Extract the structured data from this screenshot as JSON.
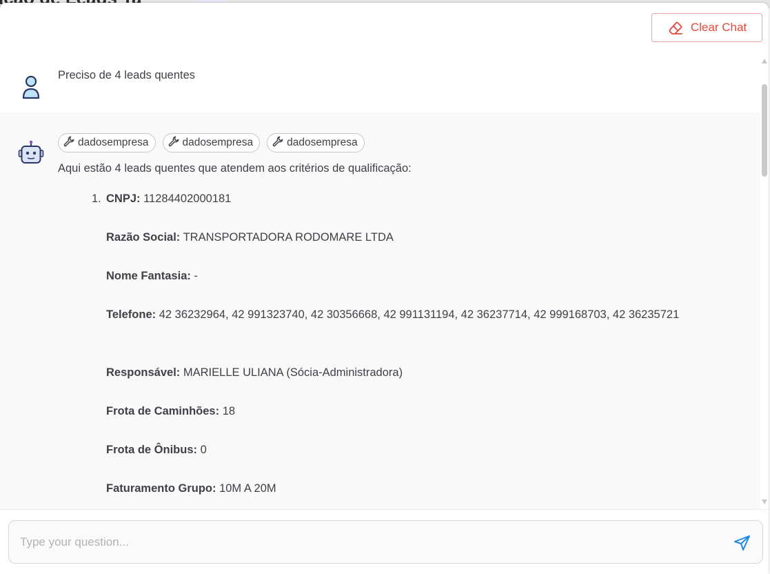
{
  "background": {
    "title_fragment": "icao de Leads   Ta"
  },
  "header": {
    "clear_label": "Clear Chat",
    "clear_icon": "eraser-icon"
  },
  "messages": {
    "user": {
      "avatar_icon": "user-icon",
      "text": "Preciso de 4 leads quentes"
    },
    "assistant": {
      "avatar_icon": "robot-icon",
      "tool_calls": [
        "dadosempresa",
        "dadosempresa",
        "dadosempresa"
      ],
      "intro": "Aqui estão 4 leads quentes que atendem aos critérios de qualificação:",
      "lead": {
        "number": "1.",
        "cnpj_label": "CNPJ:",
        "cnpj_value": " 11284402000181",
        "razao_label": "Razão Social:",
        "razao_value": " TRANSPORTADORA RODOMARE LTDA",
        "fantasia_label": "Nome Fantasia:",
        "fantasia_value": " -",
        "telefone_label": "Telefone:",
        "telefone_value": " 42 36232964, 42 991323740, 42 30356668, 42 991131194, 42 36237714, 42 999168703, 42 36235721",
        "responsavel_label": "Responsável:",
        "responsavel_value": " MARIELLE ULIANA (Sócia-Administradora)",
        "caminhoes_label": "Frota de Caminhões:",
        "caminhoes_value": " 18",
        "onibus_label": "Frota de Ônibus:",
        "onibus_value": " 0",
        "faturamento_label": "Faturamento Grupo:",
        "faturamento_value": " 10M A 20M"
      }
    }
  },
  "input": {
    "placeholder": "Type your question...",
    "value": "",
    "send_icon": "send-icon"
  },
  "colors": {
    "accent_red": "#e5483a",
    "send_blue": "#1e88e5",
    "bot_background": "#f9f9f9"
  }
}
